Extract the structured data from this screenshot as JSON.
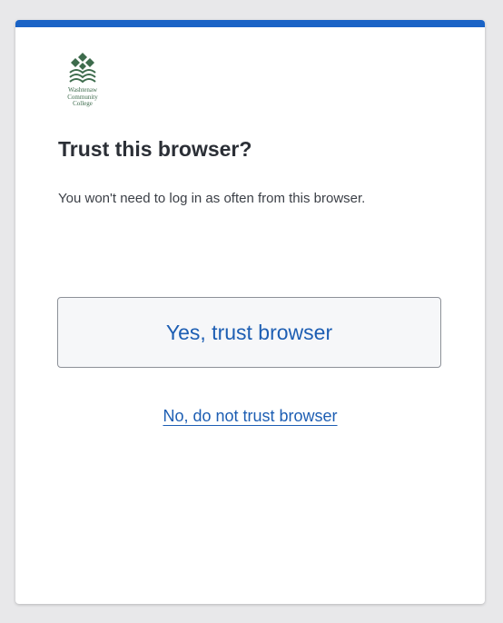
{
  "logo": {
    "name_lines": [
      "Washtenaw",
      "Community",
      "College"
    ],
    "icon": "wcc-logo-icon",
    "color": "#3d6b4c"
  },
  "dialog": {
    "title": "Trust this browser?",
    "description": "You won't need to log in as often from this browser.",
    "primary_button_label": "Yes, trust browser",
    "secondary_link_label": "No, do not trust browser"
  },
  "colors": {
    "accent": "#1a63c6",
    "link": "#1d5eb3",
    "title": "#2b2f36",
    "background": "#e8e8ea"
  }
}
